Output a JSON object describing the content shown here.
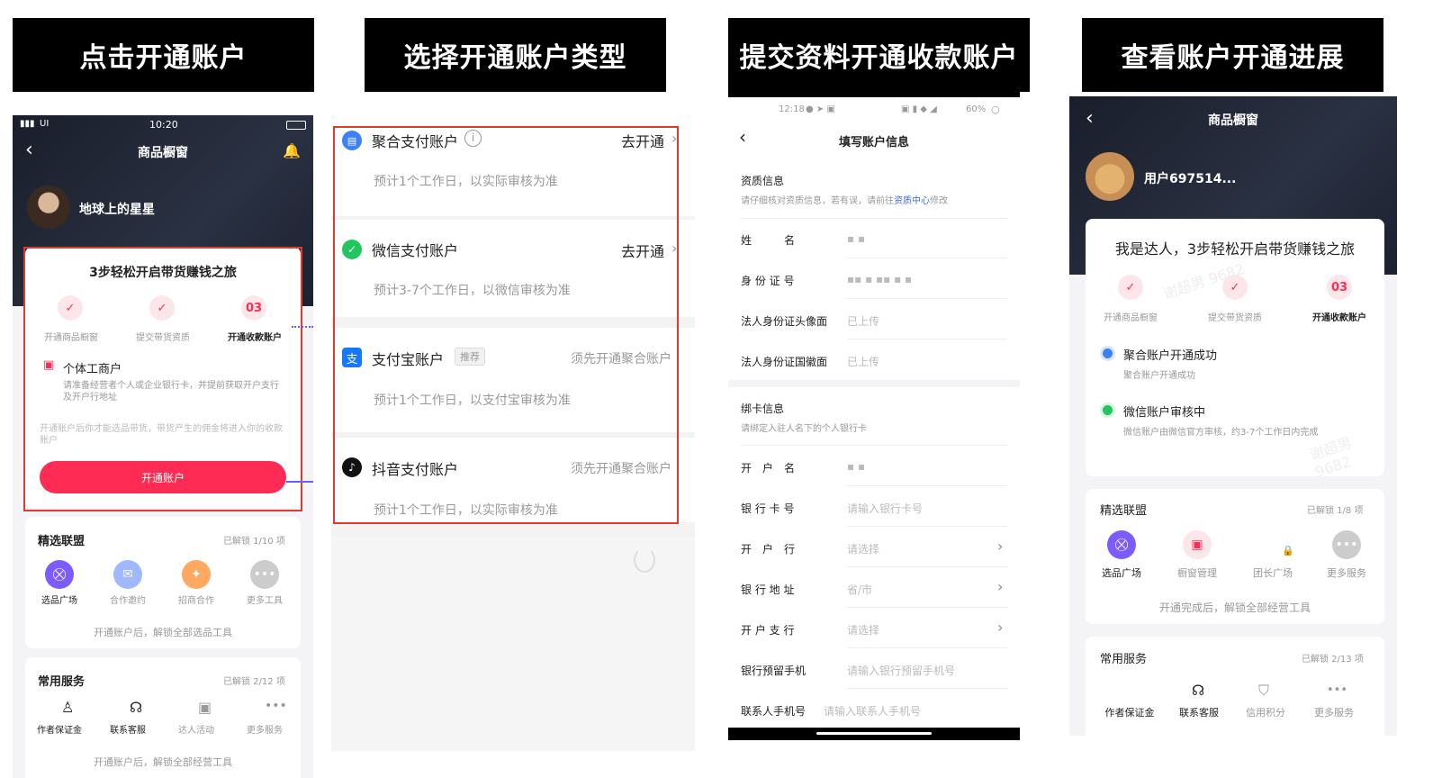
{
  "banners": [
    "点击开通账户",
    "选择开通账户类型",
    "提交资料开通收款账户",
    "查看账户开通进展"
  ],
  "p1": {
    "status_time": "10:20",
    "status_left": "UI",
    "title": "商品橱窗",
    "username": "地球上的星星",
    "steps_title": "3步轻松开启带货赚钱之旅",
    "steps": [
      {
        "label": "开通商品橱窗",
        "mark": "✓"
      },
      {
        "label": "提交带货资质",
        "mark": "✓"
      },
      {
        "label": "开通收款账户",
        "mark": "03"
      }
    ],
    "merchant_title": "个体工商户",
    "merchant_desc": "请准备经营者个人或企业银行卡，并提前获取开户支行及开户行地址",
    "note": "开通账户后你才能选品带货，带货产生的佣金将进入你的收款账户",
    "open_button": "开通账户",
    "alliance_title": "精选联盟",
    "alliance_badge": "已解锁 1/10 项",
    "alliance_items": [
      "选品广场",
      "合作邀约",
      "招商合作",
      "更多工具"
    ],
    "alliance_footer": "开通账户后，解锁全部选品工具",
    "service_title": "常用服务",
    "service_badge": "已解锁 2/12 项",
    "service_items": [
      "作者保证金",
      "联系客服",
      "达人活动",
      "更多服务"
    ],
    "service_footer": "开通账户后，解锁全部经营工具"
  },
  "p2": {
    "accounts": [
      {
        "name": "聚合支付账户",
        "action": "去开通",
        "desc": "预计1个工作日，以实际审核为准",
        "icon_color": "#3b82f6"
      },
      {
        "name": "微信支付账户",
        "action": "去开通",
        "desc": "预计3-7个工作日，以微信审核为准",
        "icon_color": "#22c55e"
      },
      {
        "name": "支付宝账户",
        "tag": "推荐",
        "action": "须先开通聚合账户",
        "desc": "预计1个工作日，以支付宝审核为准",
        "icon_color": "#1677ff"
      },
      {
        "name": "抖音支付账户",
        "action": "须先开通聚合账户",
        "desc": "预计1个工作日，以实际审核为准",
        "icon_color": "#111111"
      }
    ]
  },
  "p3": {
    "status_time": "12:18",
    "battery": "60%",
    "title": "填写账户信息",
    "qual_title": "资质信息",
    "qual_desc_1": "请仔细核对资质信息，若有误，请前往",
    "qual_link": "资质中心",
    "qual_desc_2": "修改",
    "qual_rows": [
      {
        "label": "姓　　　名",
        "value": "▪ ▪"
      },
      {
        "label": "身 份 证 号",
        "value": "▪▪  ▪ ▪▪ ▪ ▪"
      },
      {
        "label": "法人身份证头像面",
        "value": "已上传"
      },
      {
        "label": "法人身份证国徽面",
        "value": "已上传"
      }
    ],
    "bind_title": "绑卡信息",
    "bind_desc": "请绑定入驻人名下的个人银行卡",
    "bind_rows": [
      {
        "label": "开　户　名",
        "value": "▪ ▪",
        "arrow": ""
      },
      {
        "label": "银 行 卡 号",
        "value": "请输入银行卡号",
        "arrow": ""
      },
      {
        "label": "开　户　行",
        "value": "请选择",
        "arrow": "›"
      },
      {
        "label": "银 行 地 址",
        "value": "省/市",
        "arrow": "›"
      },
      {
        "label": "开 户 支 行",
        "value": "请选择",
        "arrow": "›"
      },
      {
        "label": "银行预留手机",
        "value": "请输入银行预留手机号",
        "arrow": ""
      },
      {
        "label": "联系人手机号",
        "value": "请输入联系人手机号",
        "arrow": ""
      }
    ]
  },
  "p4": {
    "title": "商品橱窗",
    "username": "用户697514...",
    "steps_title": "我是达人，3步轻松开启带货赚钱之旅",
    "steps": [
      {
        "label": "开通商品橱窗",
        "mark": "✓"
      },
      {
        "label": "提交带货资质",
        "mark": "✓"
      },
      {
        "label": "开通收款账户",
        "mark": "03"
      }
    ],
    "status_items": [
      {
        "title": "聚合账户开通成功",
        "desc": "聚合账户开通成功",
        "color": "#3b82f6"
      },
      {
        "title": "微信账户审核中",
        "desc": "微信账户由微信官方审核，约3-7个工作日内完成",
        "color": "#22c55e"
      }
    ],
    "alliance_title": "精选联盟",
    "alliance_badge": "已解锁 1/8 项",
    "alliance_items": [
      "选品广场",
      "橱窗管理",
      "团长广场",
      "更多服务"
    ],
    "alliance_footer": "开通完成后，解锁全部经营工具",
    "service_title": "常用服务",
    "service_badge": "已解锁 2/13 项",
    "service_items": [
      "作者保证金",
      "联系客服",
      "信用积分",
      "更多服务"
    ],
    "watermark": "谢超男 9682"
  },
  "colors": {
    "accent": "#fe2c55",
    "dark_bg": "#1e2330",
    "panel_bg": "#f4f4f6",
    "highlight": "#e03a2f"
  }
}
